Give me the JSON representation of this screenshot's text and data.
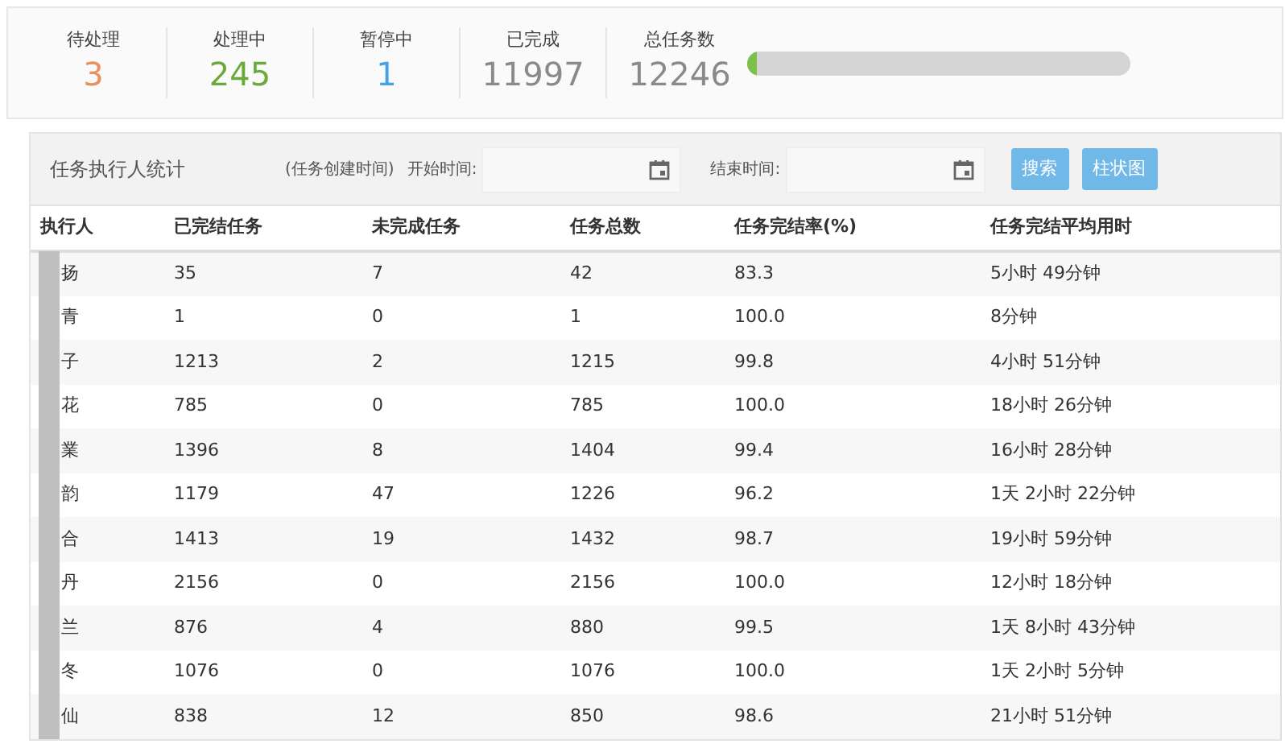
{
  "summary": {
    "stats": [
      {
        "label": "待处理",
        "value": "3",
        "color": "#e8915a"
      },
      {
        "label": "处理中",
        "value": "245",
        "color": "#6aaa3a"
      },
      {
        "label": "暂停中",
        "value": "1",
        "color": "#45a2e6"
      },
      {
        "label": "已完成",
        "value": "11997",
        "color": "#8a8a8a"
      },
      {
        "label": "总任务数",
        "value": "12246",
        "color": "#8a8a8a"
      }
    ],
    "progress": {
      "level": 0.02
    }
  },
  "panel": {
    "title": "任务执行人统计",
    "note": "(任务创建时间)",
    "filters": [
      {
        "label": "开始时间:"
      },
      {
        "label": "结束时间:"
      }
    ],
    "buttons": [
      "搜索",
      "柱状图"
    ]
  },
  "table": {
    "columns": [
      "执行人",
      "已完结任务",
      "未完成任务",
      "任务总数",
      "任务完结率(%)",
      "任务完结平均用时"
    ],
    "rows": [
      [
        "扬",
        "35",
        "7",
        "42",
        "83.3",
        "5小时 49分钟"
      ],
      [
        "青",
        "1",
        "0",
        "1",
        "100.0",
        "8分钟"
      ],
      [
        "子",
        "1213",
        "2",
        "1215",
        "99.8",
        "4小时 51分钟"
      ],
      [
        "花",
        "785",
        "0",
        "785",
        "100.0",
        "18小时 26分钟"
      ],
      [
        "業",
        "1396",
        "8",
        "1404",
        "99.4",
        "16小时 28分钟"
      ],
      [
        "韵",
        "1179",
        "47",
        "1226",
        "96.2",
        "1天 2小时 22分钟"
      ],
      [
        "合",
        "1413",
        "19",
        "1432",
        "98.7",
        "19小时 59分钟"
      ],
      [
        "丹",
        "2156",
        "0",
        "2156",
        "100.0",
        "12小时 18分钟"
      ],
      [
        "兰",
        "876",
        "4",
        "880",
        "99.5",
        "1天 8小时 43分钟"
      ],
      [
        "冬",
        "1076",
        "0",
        "1076",
        "100.0",
        "1天 2小时 5分钟"
      ],
      [
        "仙",
        "838",
        "12",
        "850",
        "98.6",
        "21小时 51分钟"
      ]
    ]
  }
}
